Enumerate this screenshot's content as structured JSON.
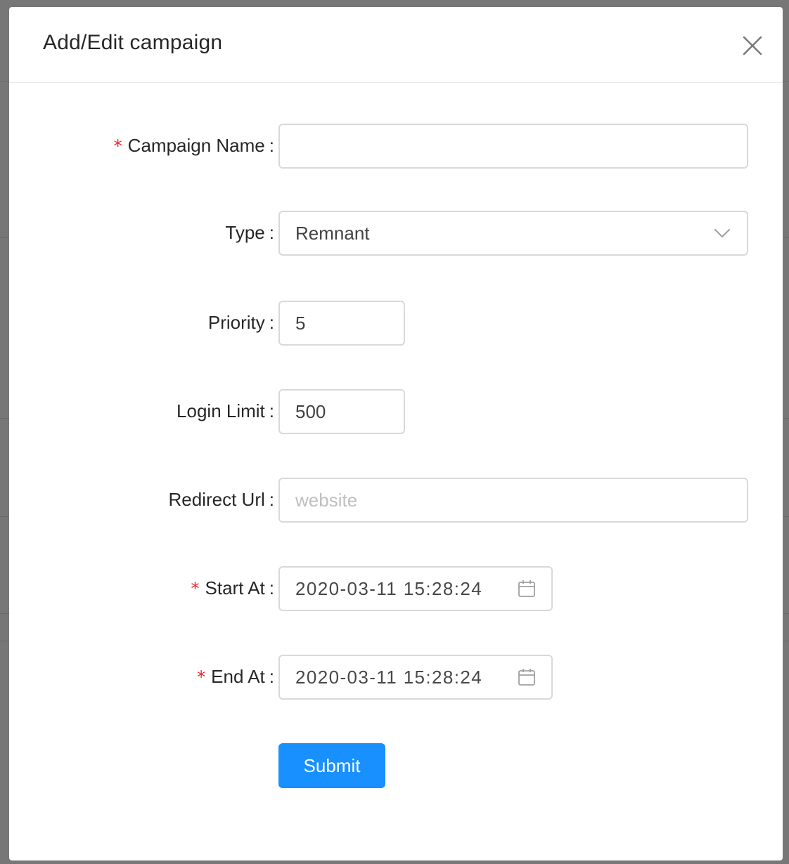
{
  "modal": {
    "title": "Add/Edit campaign"
  },
  "form": {
    "campaign_name": {
      "label": "Campaign Name",
      "required": true,
      "value": ""
    },
    "type": {
      "label": "Type",
      "required": false,
      "value": "Remnant"
    },
    "priority": {
      "label": "Priority",
      "required": false,
      "value": "5"
    },
    "login_limit": {
      "label": "Login Limit",
      "required": false,
      "value": "500"
    },
    "redirect_url": {
      "label": "Redirect Url",
      "required": false,
      "value": "",
      "placeholder": "website"
    },
    "start_at": {
      "label": "Start At",
      "required": true,
      "value": "2020-03-11 15:28:24"
    },
    "end_at": {
      "label": "End At",
      "required": true,
      "value": "2020-03-11 15:28:24"
    },
    "colon": ":",
    "required_mark": "*",
    "submit_label": "Submit"
  },
  "icons": {
    "close": "close-icon",
    "chevron": "chevron-down-icon",
    "calendar": "calendar-icon"
  },
  "colors": {
    "primary": "#1890ff",
    "required": "#f5222d",
    "border": "#d9d9d9",
    "placeholder": "#bfbfbf"
  }
}
